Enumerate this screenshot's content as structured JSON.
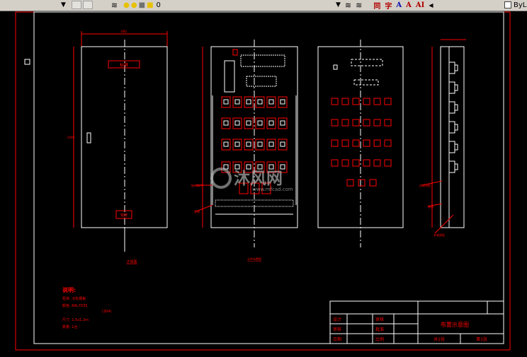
{
  "toolbar": {
    "layer_value": "0",
    "linetype_value": "ByL",
    "text_style_buttons": [
      "同",
      "字",
      "A",
      "A",
      "AI"
    ],
    "icons": [
      "dropdown-arrow-icon",
      "layer-manager-icon",
      "layer-state-icon",
      "bulb-icon",
      "sun-icon",
      "lock-icon",
      "color-swatch-icon",
      "text-style-icon",
      "scroll-arrow-icon"
    ]
  },
  "drawing": {
    "panel1_plate": "标牌",
    "panel1_bottom_label": "铭牌",
    "panel1_caption": "正视图",
    "panel2_caption": "元件布置图",
    "panel2_side_label_1": "接线端子",
    "panel2_side_label_2": "零排",
    "panel4_side_label_1": "进线电缆",
    "panel4_side_label_2": "接地",
    "panel4_bottom_label": "安装底板",
    "watermark_brand": "沐风网",
    "watermark_url": "www.mfcad.com"
  },
  "notes": {
    "title": "说明:",
    "lines": [
      "柜体: 冷轧钢板",
      "颜色: RAL7035",
      "(304)",
      "尺寸: 1.5x1.2m",
      "数量: 1台"
    ]
  },
  "title_block": {
    "rows": [
      {
        "label": "设计",
        "col3": "审核"
      },
      {
        "label": "审核",
        "col3": "批准"
      },
      {
        "label": "日期",
        "col3": "比例"
      }
    ],
    "drawing_title": "布置示意图",
    "sheet_total": "共1张",
    "sheet_no": "第1张"
  },
  "colors": {
    "background": "#000000",
    "frame": "#ff0000",
    "outline": "#ffffff",
    "component": "#ff0000",
    "dimension": "#ff0000"
  }
}
